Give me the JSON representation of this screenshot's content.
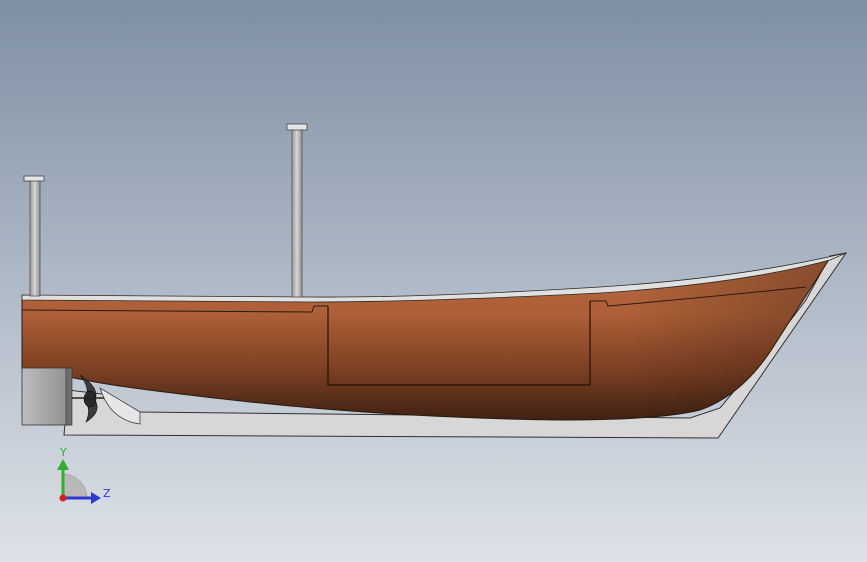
{
  "triad": {
    "y_label": "Y",
    "z_label": "Z"
  },
  "colors": {
    "background_top": "#7f8fa4",
    "background_bottom": "#dde2e8",
    "hull_light": "#b76a42",
    "hull_dark": "#4a2616",
    "keel_plate": "#d4d4d4",
    "mast": "#c3c3c3",
    "axis_y": "#2fae2f",
    "axis_z": "#2b3bd1",
    "axis_x": "#d22020"
  }
}
